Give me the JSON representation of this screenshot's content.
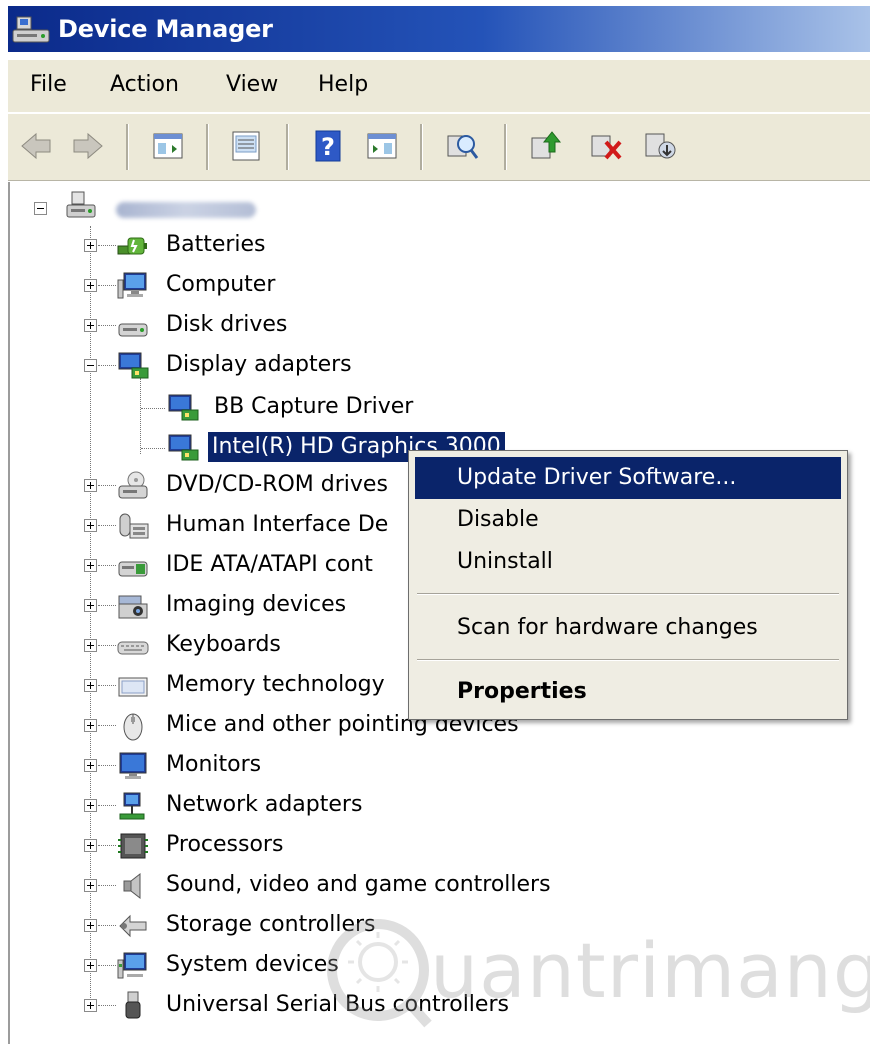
{
  "window": {
    "title": "Device Manager"
  },
  "menu": {
    "items": [
      "File",
      "Action",
      "View",
      "Help"
    ]
  },
  "toolbar": {
    "buttons": [
      "back-icon",
      "forward-icon",
      "show-hide-tree-icon",
      "properties-icon",
      "help-icon",
      "action-pane-icon",
      "scan-hardware-icon",
      "update-driver-icon",
      "disable-device-icon",
      "uninstall-device-icon"
    ]
  },
  "tree": {
    "root_label": "",
    "categories": [
      {
        "label": "Batteries",
        "icon": "battery-icon",
        "expanded": false
      },
      {
        "label": "Computer",
        "icon": "computer-icon",
        "expanded": false
      },
      {
        "label": "Disk drives",
        "icon": "disk-drive-icon",
        "expanded": false
      },
      {
        "label": "Display adapters",
        "icon": "display-adapter-icon",
        "expanded": true
      },
      {
        "label": "DVD/CD-ROM drives",
        "icon": "dvd-drive-icon",
        "expanded": false
      },
      {
        "label": "Human Interface De",
        "icon": "hid-icon",
        "expanded": false
      },
      {
        "label": "IDE ATA/ATAPI cont",
        "icon": "ide-icon",
        "expanded": false
      },
      {
        "label": "Imaging devices",
        "icon": "camera-icon",
        "expanded": false
      },
      {
        "label": "Keyboards",
        "icon": "keyboard-icon",
        "expanded": false
      },
      {
        "label": "Memory technology",
        "icon": "memory-icon",
        "expanded": false
      },
      {
        "label": "Mice and other pointing devices",
        "icon": "mouse-icon",
        "expanded": false
      },
      {
        "label": "Monitors",
        "icon": "monitor-icon",
        "expanded": false
      },
      {
        "label": "Network adapters",
        "icon": "network-icon",
        "expanded": false
      },
      {
        "label": "Processors",
        "icon": "processor-icon",
        "expanded": false
      },
      {
        "label": "Sound, video and game controllers",
        "icon": "speaker-icon",
        "expanded": false
      },
      {
        "label": "Storage controllers",
        "icon": "storage-icon",
        "expanded": false
      },
      {
        "label": "System devices",
        "icon": "system-devices-icon",
        "expanded": false
      },
      {
        "label": "Universal Serial Bus controllers",
        "icon": "usb-icon",
        "expanded": false
      }
    ],
    "display_adapters_children": [
      {
        "label": "BB Capture Driver",
        "selected": false
      },
      {
        "label": "Intel(R) HD Graphics 3000",
        "selected": true
      }
    ]
  },
  "context_menu": {
    "items": [
      {
        "label": "Update Driver Software...",
        "highlighted": true
      },
      {
        "label": "Disable"
      },
      {
        "label": "Uninstall"
      },
      {
        "label": "Scan for hardware changes"
      },
      {
        "label": "Properties",
        "bold": true
      }
    ]
  },
  "watermark": {
    "text": "uantrimang"
  },
  "colors": {
    "selection": "#0a246a",
    "title_start": "#0b2a8a",
    "title_end": "#a9c2e8",
    "menu_bg": "#ece9d8"
  }
}
